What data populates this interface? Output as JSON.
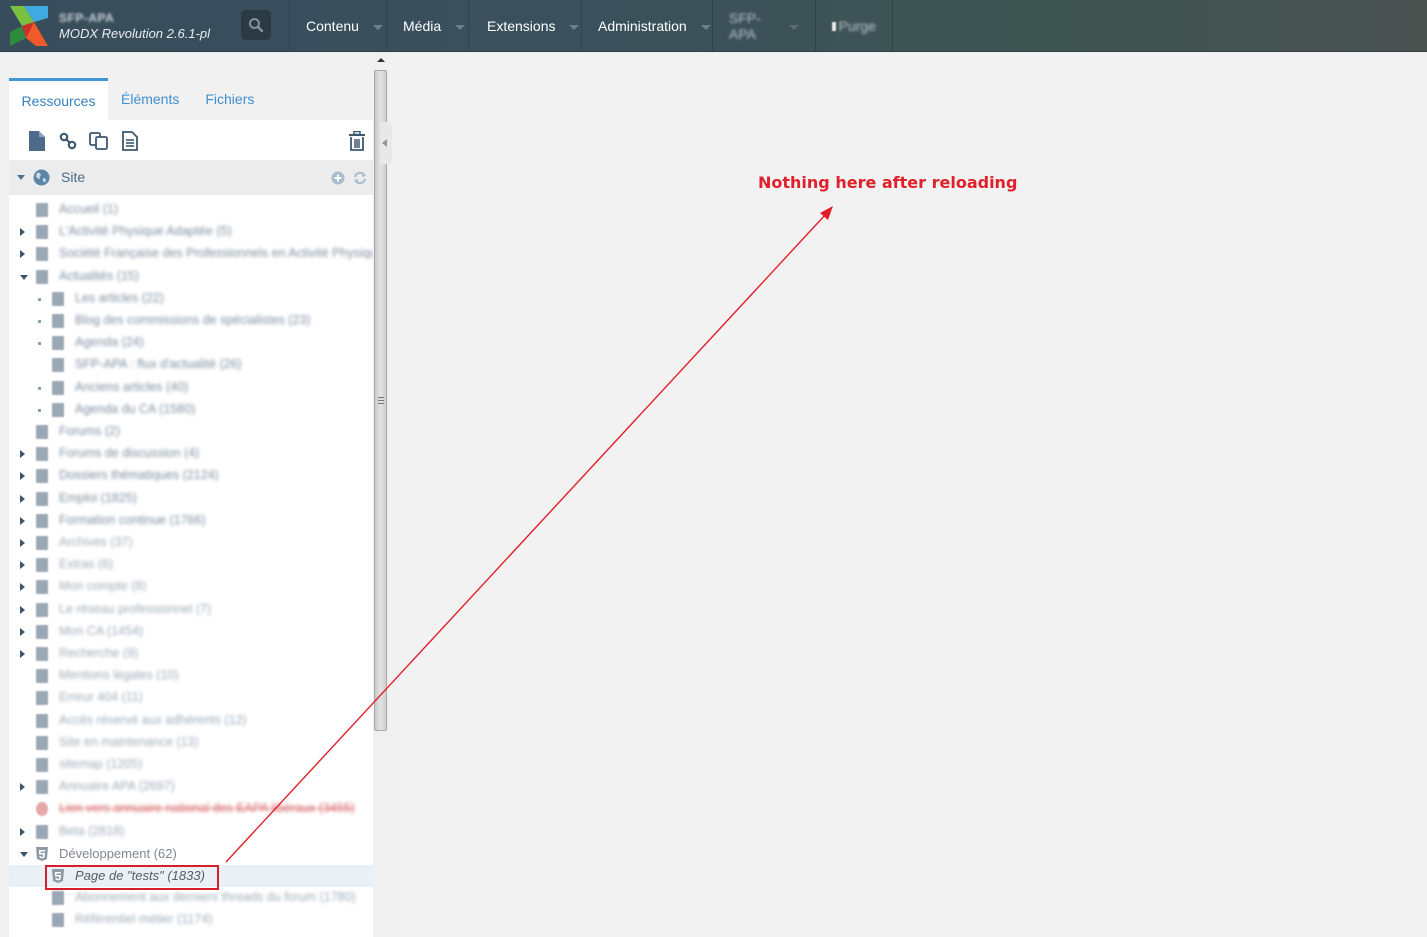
{
  "header": {
    "site_name": "SFP-APA",
    "version": "MODX Revolution 2.6.1-pl",
    "search_icon": "search-icon",
    "nav": [
      {
        "label": "Contenu",
        "has_caret": true
      },
      {
        "label": "Média",
        "has_caret": true
      },
      {
        "label": "Extensions",
        "has_caret": true
      },
      {
        "label": "Administration",
        "has_caret": true
      },
      {
        "label": "SFP-APA",
        "has_caret": true
      },
      {
        "label": "Purge",
        "has_caret": false
      }
    ]
  },
  "left_panel": {
    "tabs": [
      {
        "label": "Ressources",
        "active": true
      },
      {
        "label": "Éléments",
        "active": false
      },
      {
        "label": "Fichiers",
        "active": false
      }
    ],
    "toolbar": {
      "icons": [
        "new-document-icon",
        "new-weblink-icon",
        "new-symlink-icon",
        "new-static-resource-icon",
        "trash-icon"
      ]
    },
    "site_row": {
      "label": "Site",
      "icons": [
        "globe-icon",
        "add-icon",
        "refresh-icon"
      ]
    },
    "tree": [
      {
        "label": "Accueil (1)",
        "level": 0,
        "expander": "none"
      },
      {
        "label": "L'Activité Physique Adaptée (5)",
        "level": 0,
        "expander": "closed"
      },
      {
        "label": "Société Française des Professionnels en Activité Physique",
        "level": 0,
        "expander": "closed"
      },
      {
        "label": "Actualités (15)",
        "level": 0,
        "expander": "open"
      },
      {
        "label": "Les articles (22)",
        "level": 1,
        "expander": "dot"
      },
      {
        "label": "Blog des commissions de spécialistes (23)",
        "level": 1,
        "expander": "dot"
      },
      {
        "label": "Agenda (24)",
        "level": 1,
        "expander": "dot"
      },
      {
        "label": "SFP-APA : flux d'actualité (26)",
        "level": 1,
        "expander": "none"
      },
      {
        "label": "Anciens articles (40)",
        "level": 1,
        "expander": "dot"
      },
      {
        "label": "Agenda du CA (1580)",
        "level": 1,
        "expander": "dot"
      },
      {
        "label": "Forums (2)",
        "level": 0,
        "expander": "none"
      },
      {
        "label": "Forums de discussion (4)",
        "level": 0,
        "expander": "closed"
      },
      {
        "label": "Dossiers thématiques (2124)",
        "level": 0,
        "expander": "closed"
      },
      {
        "label": "Emploi (1825)",
        "level": 0,
        "expander": "closed"
      },
      {
        "label": "Formation continue (1766)",
        "level": 0,
        "expander": "closed"
      },
      {
        "label": "Archives (37)",
        "level": 0,
        "expander": "closed"
      },
      {
        "label": "Extras (6)",
        "level": 0,
        "expander": "closed"
      },
      {
        "label": "Mon compte (8)",
        "level": 0,
        "expander": "closed"
      },
      {
        "label": "Le réseau professionnel (7)",
        "level": 0,
        "expander": "closed"
      },
      {
        "label": "Mon CA (1454)",
        "level": 0,
        "expander": "closed"
      },
      {
        "label": "Recherche (9)",
        "level": 0,
        "expander": "closed"
      },
      {
        "label": "Mentions légales (10)",
        "level": 0,
        "expander": "none"
      },
      {
        "label": "Erreur 404 (11)",
        "level": 0,
        "expander": "none"
      },
      {
        "label": "Accès réservé aux adhérents (12)",
        "level": 0,
        "expander": "none"
      },
      {
        "label": "Site en maintenance (13)",
        "level": 0,
        "expander": "none"
      },
      {
        "label": "sitemap (1205)",
        "level": 0,
        "expander": "none"
      },
      {
        "label": "Annuaire APA (2697)",
        "level": 0,
        "expander": "closed"
      },
      {
        "label": "Lien vers annuaire national des EAPA libéraux (3455)",
        "level": 0,
        "expander": "none",
        "style": "red"
      },
      {
        "label": "Beta (2818)",
        "level": 0,
        "expander": "closed"
      },
      {
        "label": "Développement (62)",
        "level": 0,
        "expander": "open",
        "style": "clear"
      },
      {
        "label": "Page de \"tests\" (1833)",
        "level": 1,
        "expander": "none",
        "style": "selected"
      },
      {
        "label": "Abonnement aux derniers threads du forum (1780)",
        "level": 1,
        "expander": "none"
      },
      {
        "label": "Référentiel métier (1174)",
        "level": 1,
        "expander": "none"
      }
    ]
  },
  "annotation": {
    "text": "Nothing here after reloading",
    "color": "#e0202a"
  },
  "colors": {
    "accent": "#3e97d1",
    "header_start": "#384d5b",
    "header_end": "#4a5250",
    "annotation_red": "#d71f2a"
  }
}
